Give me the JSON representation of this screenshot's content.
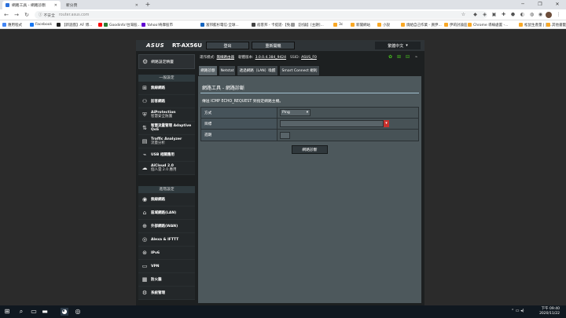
{
  "browser": {
    "tabs": [
      {
        "title": "網路工具 - 網路診斷"
      },
      {
        "title": "新分頁"
      }
    ],
    "security_label": "不安全",
    "url": "router.asus.com",
    "bookmarks": [
      {
        "label": "應用程式",
        "color": "#4285f4"
      },
      {
        "label": "Facebook",
        "color": "#1877f2"
      },
      {
        "label": "【新遊戲】AF 博...",
        "color": "#222222"
      },
      {
        "label": "",
        "color": "#ff0000"
      },
      {
        "label": "Goodinfo!台灣股...",
        "color": "#2e7d32"
      },
      {
        "label": "Yahoo!奇摩股市",
        "color": "#6001d2"
      },
      {
        "label": "富邦藍杉電信‧全球...",
        "color": "#1565c0"
      },
      {
        "label": "痞客邦 - 卡提諾-【免...",
        "color": "#444444"
      },
      {
        "label": "【討論】[主題]...",
        "color": "#999999"
      },
      {
        "label": "3c",
        "color": "#f9a825"
      },
      {
        "label": "新聞網站",
        "color": "#f9a825"
      },
      {
        "label": "小說",
        "color": "#f9a825"
      },
      {
        "label": "燒給自己作業 - 買伊...",
        "color": "#f9a825"
      },
      {
        "label": "伊莉討論區",
        "color": "#f9a825"
      },
      {
        "label": "Chrome 導線處置 -...",
        "color": "#f9a825"
      },
      {
        "label": "松鼠生產量 | 買...",
        "color": "#f9a825"
      },
      {
        "label": "其他書籤",
        "color": "#f9a825"
      }
    ]
  },
  "router": {
    "brand": "ASUS",
    "model": "RT-AX56U",
    "top_buttons": [
      "登出",
      "重新開機"
    ],
    "language": "繁體中文",
    "info": {
      "mode_label": "運作模式:",
      "mode_value": "無線路由器",
      "firmware_label": "韌體版本:",
      "firmware_value": "3.0.0.4.384_9424",
      "ssid_label": "SSID:",
      "ssid_value": "ASUS_F0"
    },
    "quick_setup": "網路設定精靈",
    "general_header": "一般設定",
    "general_items": [
      {
        "label": "無線網路",
        "sub": "",
        "icon": "network-map-icon",
        "glyph": "⊞"
      },
      {
        "label": "訪客網路",
        "sub": "",
        "icon": "guest-network-icon",
        "glyph": "⚇"
      },
      {
        "label": "AiProtection",
        "sub": "智慧安全防護",
        "icon": "aiprotection-icon",
        "glyph": "⛨"
      },
      {
        "label": "智慧流量管理 Adaptive QoS",
        "sub": "",
        "icon": "qos-icon",
        "glyph": "⇅"
      },
      {
        "label": "Traffic Analyzer",
        "sub": "流量分析",
        "icon": "traffic-analyzer-icon",
        "glyph": "▤"
      },
      {
        "label": "USB 相關應用",
        "sub": "",
        "icon": "usb-icon",
        "glyph": "⌁"
      },
      {
        "label": "AiCloud 2.0",
        "sub": "個人雲 2.0 應用",
        "icon": "aicloud-icon",
        "glyph": "☁"
      }
    ],
    "advanced_header": "進階設定",
    "advanced_items": [
      {
        "label": "無線網路",
        "icon": "wireless-icon",
        "glyph": "◉"
      },
      {
        "label": "區域網路(LAN)",
        "icon": "lan-icon",
        "glyph": "⌂"
      },
      {
        "label": "外部網路(WAN)",
        "icon": "wan-icon",
        "glyph": "⊕"
      },
      {
        "label": "Alexa & IFTTT",
        "icon": "alexa-icon",
        "glyph": "◎"
      },
      {
        "label": "IPv6",
        "icon": "ipv6-icon",
        "glyph": "⊛"
      },
      {
        "label": "VPN",
        "icon": "vpn-icon",
        "glyph": "▭"
      },
      {
        "label": "防火牆",
        "icon": "firewall-icon",
        "glyph": "▦"
      },
      {
        "label": "系統管理",
        "icon": "administration-icon",
        "glyph": "⚙"
      }
    ],
    "content_tabs": [
      "網路診斷",
      "Netstat",
      "透過網路（LAN）喚醒",
      "Smart Connect 規則"
    ],
    "panel": {
      "title": "網路工具 - 網路診斷",
      "description": "傳送 ICMP ECHO_REQUEST 到指定網路主機。",
      "rows": [
        {
          "label": "方式",
          "value": "Ping"
        },
        {
          "label": "目標",
          "value": ""
        },
        {
          "label": "週期",
          "value": ""
        }
      ],
      "button": "網路診斷"
    }
  },
  "taskbar": {
    "time": "下午 09:40",
    "date": "2020/11/22"
  }
}
